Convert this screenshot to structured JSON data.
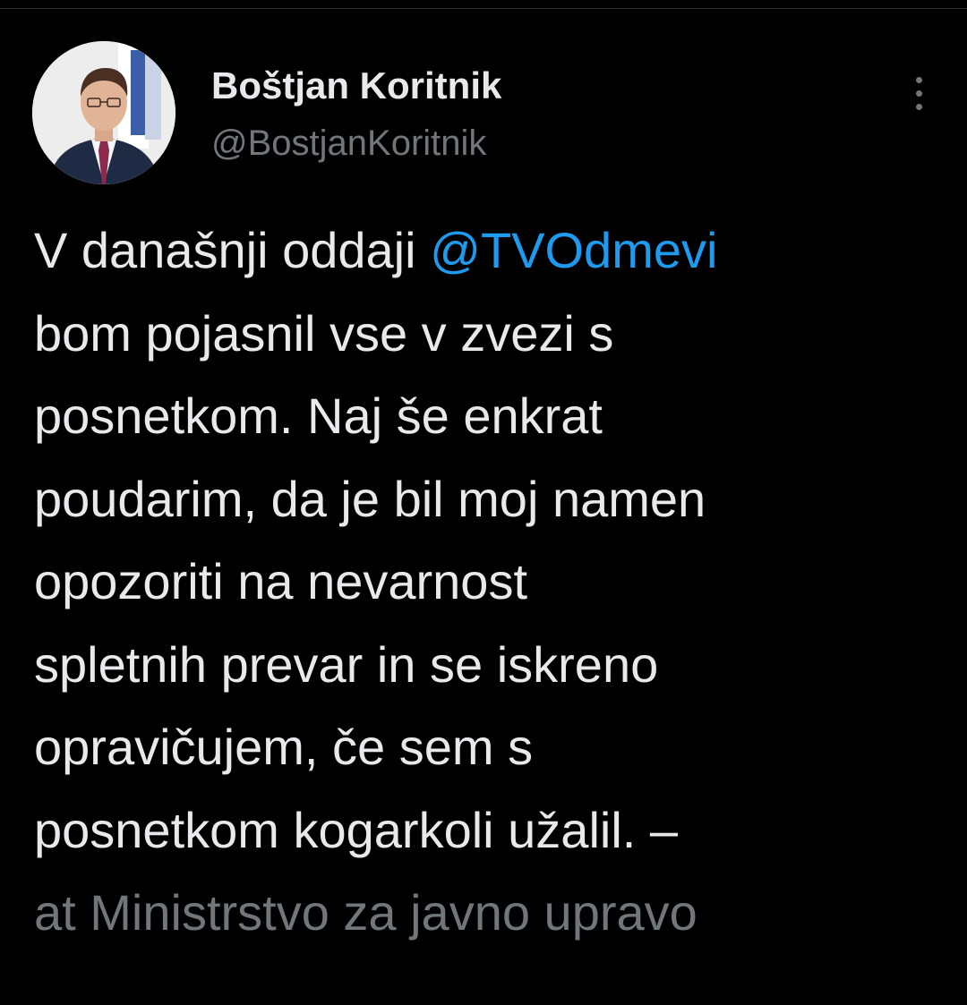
{
  "author": {
    "display_name": "Boštjan Koritnik",
    "handle": "@BostjanKoritnik"
  },
  "tweet": {
    "line1_before": "V današnji oddaji ",
    "mention": "@TVOdmevi",
    "lines": [
      "bom pojasnil vse v zvezi s",
      "posnetkom. Naj še enkrat",
      "poudarim, da je bil moj namen",
      "opozoriti na nevarnost",
      "spletnih prevar in se iskreno",
      "opravičujem, če sem s",
      "posnetkom kogarkoli užalil. –"
    ],
    "location": "at Ministrstvo za javno upravo"
  },
  "icons": {
    "more": "more-vertical-icon",
    "avatar": "profile-photo"
  },
  "colors": {
    "background": "#000000",
    "text": "#e7e9ea",
    "secondary": "#71767b",
    "accent": "#1d9bf0"
  }
}
